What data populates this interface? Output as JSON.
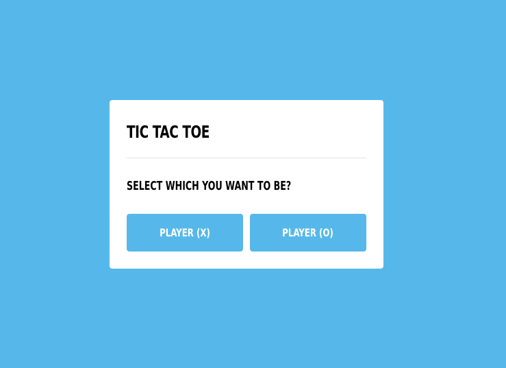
{
  "select_box": {
    "title": "TIC TAC TOE",
    "prompt": "SELECT WHICH YOU WANT TO BE?",
    "buttons": [
      {
        "label": "PLAYER (X)"
      },
      {
        "label": "PLAYER (O)"
      }
    ]
  },
  "colors": {
    "background": "#56b8ea",
    "panel": "#ffffff",
    "button": "#56b8ea",
    "text": "#000000"
  }
}
